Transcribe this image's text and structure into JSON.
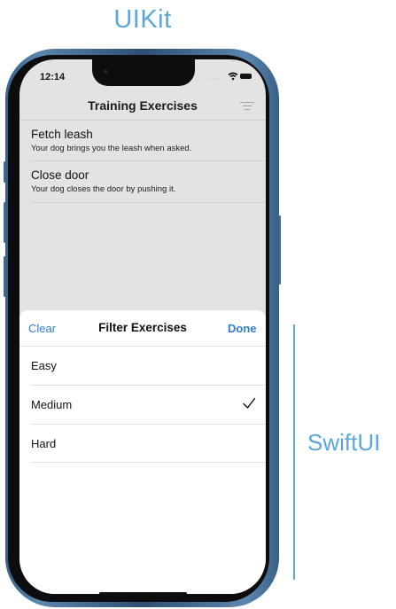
{
  "captions": {
    "top": "UIKit",
    "side": "SwiftUI"
  },
  "status_bar": {
    "time": "12:14",
    "signal": "·····",
    "icons": [
      "wifi-icon",
      "battery-icon"
    ]
  },
  "nav_bar": {
    "title": "Training Exercises",
    "filter_icon": "filter-icon"
  },
  "exercises": [
    {
      "title": "Fetch leash",
      "subtitle": "Your dog brings you the leash when asked."
    },
    {
      "title": "Close door",
      "subtitle": "Your dog closes the door by pushing it."
    }
  ],
  "filter_sheet": {
    "clear_label": "Clear",
    "title": "Filter Exercises",
    "done_label": "Done",
    "options": [
      {
        "label": "Easy",
        "selected": false
      },
      {
        "label": "Medium",
        "selected": true
      },
      {
        "label": "Hard",
        "selected": false
      }
    ]
  },
  "colors": {
    "caption": "#5ba7d9",
    "accent": "#2f7fd6",
    "phone_frame": "#3f6a91"
  }
}
